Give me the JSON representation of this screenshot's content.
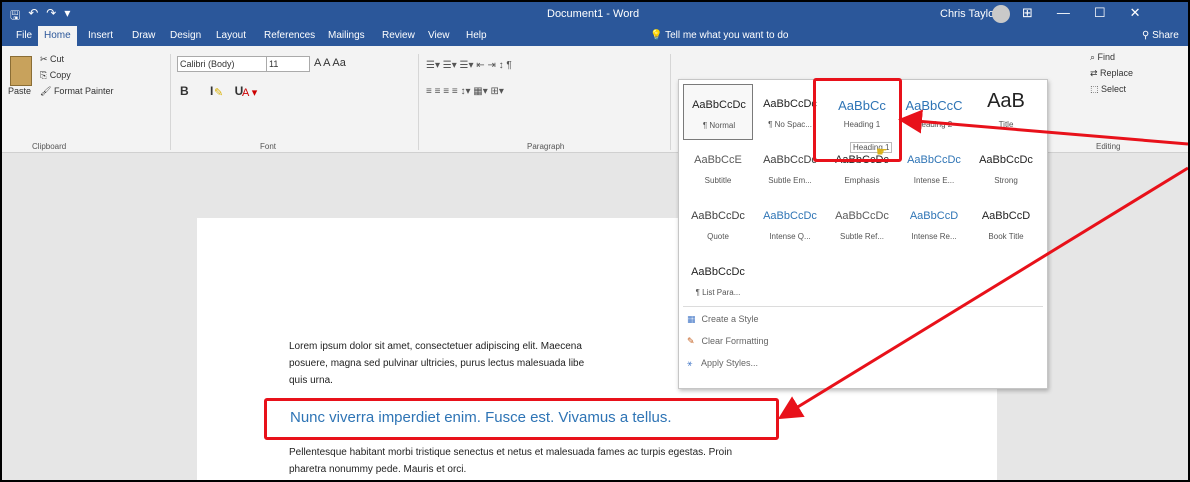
{
  "titlebar": {
    "qat_save": "🖫",
    "qat_undo": "↶",
    "qat_redo": "↷",
    "qat_more": "▾",
    "doc_title": "Document1  -  Word",
    "user_name": "Chris Taylor",
    "btn_ribbon": "⊞",
    "btn_min": "—",
    "btn_max": "☐",
    "btn_close": "✕"
  },
  "tabs": [
    {
      "label": "File"
    },
    {
      "label": "Home"
    },
    {
      "label": "Insert"
    },
    {
      "label": "Draw"
    },
    {
      "label": "Design"
    },
    {
      "label": "Layout"
    },
    {
      "label": "References"
    },
    {
      "label": "Mailings"
    },
    {
      "label": "Review"
    },
    {
      "label": "View"
    },
    {
      "label": "Help"
    }
  ],
  "tellme": "Tell me what you want to do",
  "share": "Share",
  "clipboard": {
    "paste": "Paste",
    "cut": "Cut",
    "copy": "Copy",
    "format_painter": "Format Painter",
    "label": "Clipboard"
  },
  "font": {
    "name": "Calibri (Body)",
    "size": "11",
    "grow_shrink": "A  A  Aa",
    "format_buttons": "B I U",
    "label": "Font"
  },
  "paragraph": {
    "label": "Paragraph"
  },
  "styles": [
    {
      "sample": "AaBbCcDc",
      "name": "¶ Normal",
      "color": "#222222"
    },
    {
      "sample": "AaBbCcDc",
      "name": "¶ No Spac...",
      "color": "#222222"
    },
    {
      "sample": "AaBbCc",
      "name": "Heading 1",
      "color": "#2e74b5"
    },
    {
      "sample": "AaBbCcC",
      "name": "Heading 2",
      "color": "#2e74b5"
    },
    {
      "sample": "AaB",
      "name": "Title",
      "color": "#222222"
    },
    {
      "sample": "AaBbCcE",
      "name": "Subtitle",
      "color": "#5a5a5a"
    },
    {
      "sample": "AaBbCcDc",
      "name": "Subtle Em...",
      "color": "#404040"
    },
    {
      "sample": "AaBbCcDc",
      "name": "Emphasis",
      "color": "#222222"
    },
    {
      "sample": "AaBbCcDc",
      "name": "Intense E...",
      "color": "#2e74b5"
    },
    {
      "sample": "AaBbCcDc",
      "name": "Strong",
      "color": "#222222"
    },
    {
      "sample": "AaBbCcDc",
      "name": "Quote",
      "color": "#404040"
    },
    {
      "sample": "AaBbCcDc",
      "name": "Intense Q...",
      "color": "#2e74b5"
    },
    {
      "sample": "AaBbCcDc",
      "name": "Subtle Ref...",
      "color": "#5a5a5a"
    },
    {
      "sample": "AaBbCcD",
      "name": "Intense Re...",
      "color": "#2e74b5"
    },
    {
      "sample": "AaBbCcD",
      "name": "Book Title",
      "color": "#222222"
    },
    {
      "sample": "AaBbCcDc",
      "name": "¶ List Para...",
      "color": "#222222"
    }
  ],
  "gallery_commands": {
    "create": "Create a Style",
    "clear": "Clear Formatting",
    "apply": "Apply Styles..."
  },
  "tooltip": "Heading 1",
  "editing": {
    "find": "Find",
    "replace": "Replace",
    "select": "Select",
    "label": "Editing"
  },
  "document": {
    "para1_line1": "Lorem ipsum dolor sit amet, consectetuer adipiscing elit. Maecena",
    "para1_line2": "posuere, magna sed pulvinar ultricies, purus lectus malesuada libe",
    "para1_line3": "quis urna.",
    "heading": "Nunc viverra imperdiet enim. Fusce est. Vivamus a tellus.",
    "para2_line1": "Pellentesque habitant morbi tristique senectus et netus et malesuada fames ac turpis egestas. Proin",
    "para2_line2": "pharetra nonummy pede. Mauris et orci."
  },
  "annotation_color": "#e8111a"
}
